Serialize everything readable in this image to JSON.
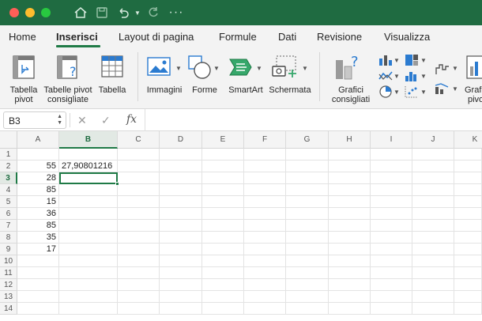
{
  "menu": {
    "tabs": [
      {
        "label": "Home"
      },
      {
        "label": "Inserisci"
      },
      {
        "label": "Layout di pagina"
      },
      {
        "label": "Formule"
      },
      {
        "label": "Dati"
      },
      {
        "label": "Revisione"
      },
      {
        "label": "Visualizza"
      }
    ],
    "active_tab": "Inserisci"
  },
  "ribbon": {
    "tabella_pivot": [
      "Tabella",
      "pivot"
    ],
    "tabelle_pivot_consigliate": [
      "Tabelle pivot",
      "consigliate"
    ],
    "tabella": "Tabella",
    "immagini": "Immagini",
    "forme": "Forme",
    "smartart": "SmartArt",
    "schermata": "Schermata",
    "grafici_consigliati": [
      "Grafici",
      "consigliati"
    ],
    "grafici_pivot": [
      "Grafi",
      "pivo"
    ]
  },
  "formula_bar": {
    "name_box": "B3",
    "fx_label": "fx",
    "formula": ""
  },
  "grid": {
    "columns": [
      "A",
      "B",
      "C",
      "D",
      "E",
      "F",
      "G",
      "H",
      "I",
      "J",
      "K"
    ],
    "rows": [
      "1",
      "2",
      "3",
      "4",
      "5",
      "6",
      "7",
      "8",
      "9",
      "10",
      "11",
      "12",
      "13",
      "14"
    ],
    "selected_cell": "B3",
    "cells": {
      "A2": "55",
      "B2": "27,90801216",
      "A3": "28",
      "A4": "85",
      "A5": "15",
      "A6": "36",
      "A7": "85",
      "A8": "35",
      "A9": "17"
    }
  },
  "colors": {
    "titlebar": "#1f6b41",
    "accent": "#1f7a46"
  }
}
